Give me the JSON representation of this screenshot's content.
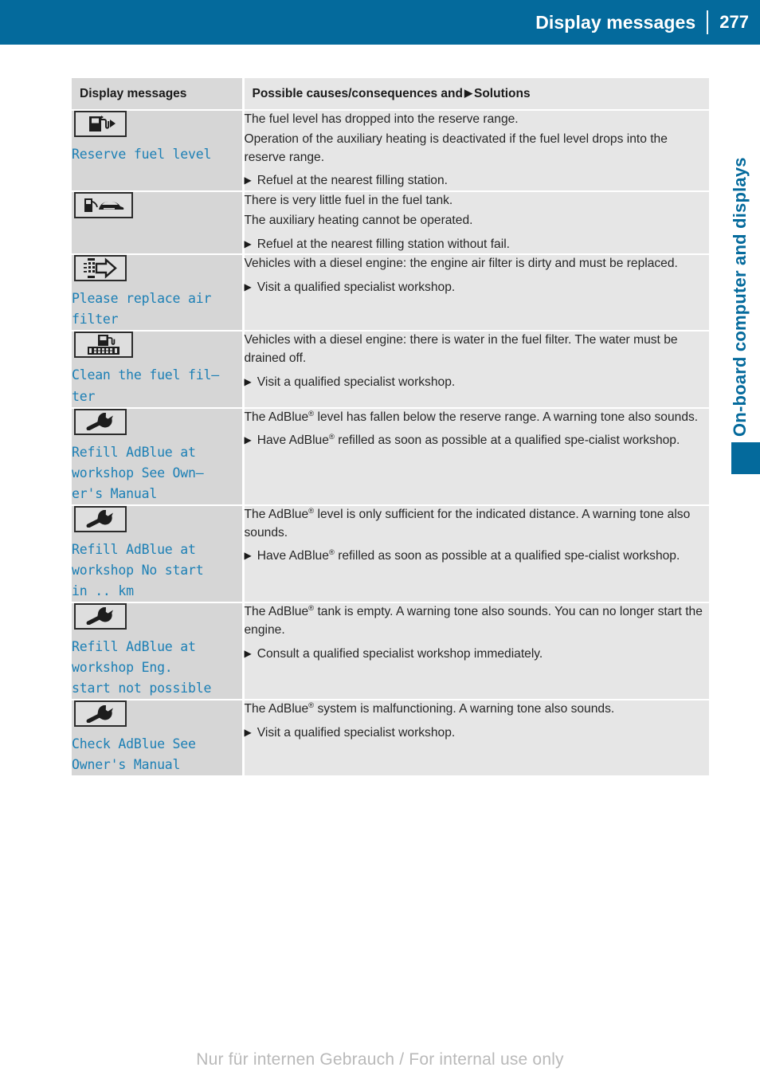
{
  "header": {
    "title": "Display messages",
    "page_number": "277"
  },
  "side": {
    "chapter_title": "On-board computer and displays"
  },
  "table": {
    "columns": {
      "left": "Display messages",
      "right_before": "Possible causes/consequences and",
      "right_marker": "▶",
      "right_after": "Solutions"
    },
    "rows": [
      {
        "icon": "fuel-pump-reserve-icon",
        "message": "Reserve fuel level",
        "paragraphs": [
          "The fuel level has dropped into the reserve range.",
          "Operation of the auxiliary heating is deactivated if the fuel level drops into the reserve range."
        ],
        "solutions": [
          "Refuel at the nearest filling station."
        ]
      },
      {
        "icon": "fuel-pump-car-icon",
        "message": "",
        "paragraphs": [
          "There is very little fuel in the fuel tank.",
          "The auxiliary heating cannot be operated."
        ],
        "solutions": [
          "Refuel at the nearest filling station without fail."
        ]
      },
      {
        "icon": "air-filter-arrow-icon",
        "message": "Please replace air\nfilter",
        "paragraphs": [
          "Vehicles with a diesel engine: the engine air filter is dirty and must be replaced."
        ],
        "solutions": [
          "Visit a qualified specialist workshop."
        ]
      },
      {
        "icon": "fuel-filter-icon",
        "message": "Clean the fuel fil–\nter",
        "paragraphs": [
          "Vehicles with a diesel engine: there is water in the fuel filter. The water must be drained off."
        ],
        "solutions": [
          "Visit a qualified specialist workshop."
        ]
      },
      {
        "icon": "wrench-icon",
        "message": "Refill AdBlue at\nworkshop See Own–\ner's Manual",
        "paragraphs_html": [
          "The AdBlue<sup>®</sup> level has fallen below the reserve range. A warning tone also sounds."
        ],
        "solutions_html": [
          "Have AdBlue<sup>®</sup> refilled as soon as possible at a qualified spe-cialist workshop."
        ]
      },
      {
        "icon": "wrench-icon",
        "message": "Refill AdBlue at\nworkshop No start\nin .. km",
        "paragraphs_html": [
          "The AdBlue<sup>®</sup> level is only sufficient for the indicated distance. A warning tone also sounds."
        ],
        "solutions_html": [
          "Have AdBlue<sup>®</sup> refilled as soon as possible at a qualified spe-cialist workshop."
        ]
      },
      {
        "icon": "wrench-icon",
        "message": "Refill AdBlue at\nworkshop Eng.\nstart not possible",
        "paragraphs_html": [
          "The AdBlue<sup>®</sup> tank is empty. A warning tone also sounds. You can no longer start the engine."
        ],
        "solutions_html": [
          "Consult a qualified specialist workshop immediately."
        ]
      },
      {
        "icon": "wrench-icon",
        "message": "Check AdBlue See\nOwner's Manual",
        "paragraphs_html": [
          "The AdBlue<sup>®</sup> system is malfunctioning. A warning tone also sounds."
        ],
        "solutions_html": [
          "Visit a qualified specialist workshop."
        ]
      }
    ]
  },
  "footer": {
    "watermark": "Nur für internen Gebrauch / For internal use only"
  },
  "colors": {
    "brand_blue": "#046a9c",
    "message_text_blue": "#1b7fb5",
    "left_cell_bg": "#d6d6d6",
    "right_cell_bg": "#e6e6e6"
  }
}
